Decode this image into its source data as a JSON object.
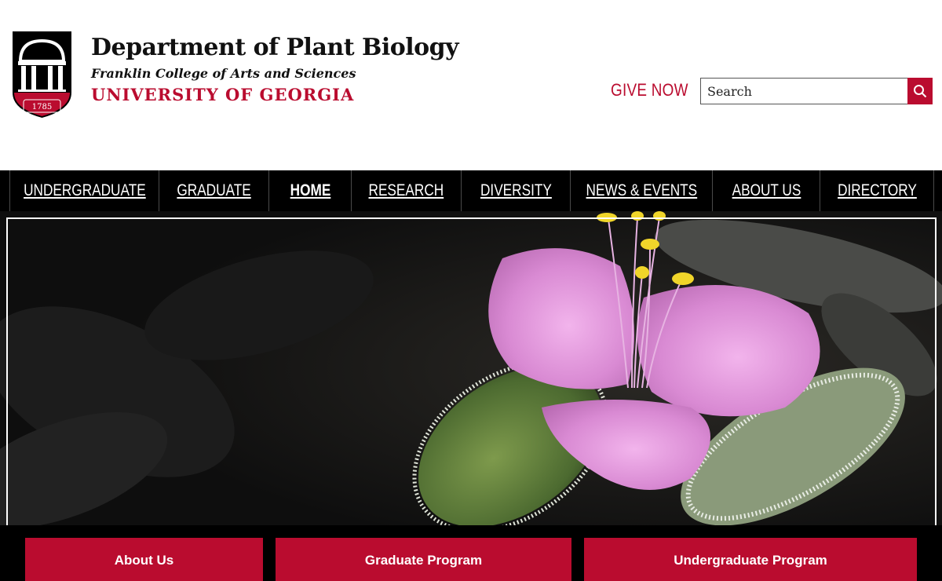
{
  "header": {
    "department": "Department of Plant Biology",
    "college": "Franklin College of Arts and Sciences",
    "university": "UNIVERSITY OF GEORGIA",
    "logo_year": "1785",
    "give_now": "GIVE NOW",
    "search": {
      "placeholder": "Search",
      "value": ""
    }
  },
  "nav": {
    "items": [
      {
        "label": "UNDERGRADUATE"
      },
      {
        "label": "GRADUATE"
      },
      {
        "label": "HOME",
        "active": true
      },
      {
        "label": "RESEARCH"
      },
      {
        "label": "DIVERSITY"
      },
      {
        "label": "NEWS & EVENTS"
      },
      {
        "label": "ABOUT US"
      },
      {
        "label": "DIRECTORY"
      }
    ]
  },
  "hero": {
    "image": "pink spiderwort flower with yellow stamens on fuzzy green leaves"
  },
  "cta": {
    "about": "About Us",
    "graduate": "Graduate Program",
    "undergraduate": "Undergraduate Program"
  },
  "colors": {
    "brand_red": "#ba0c2f",
    "nav_black": "#000000"
  }
}
